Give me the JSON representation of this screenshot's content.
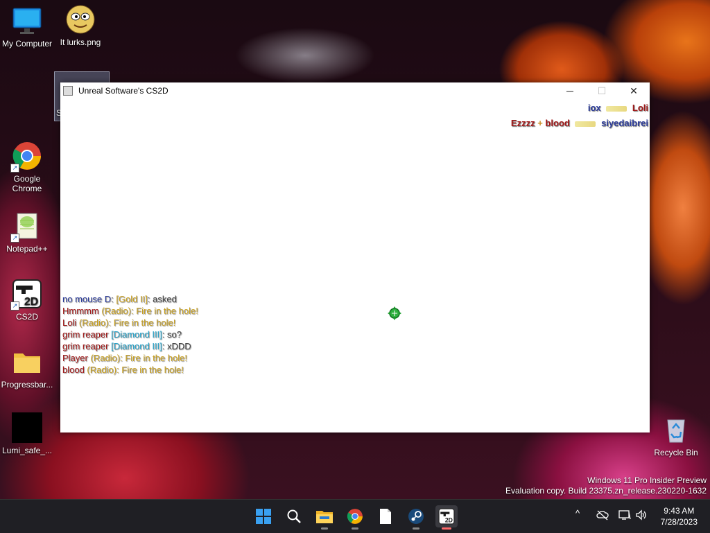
{
  "desktop": {
    "icons": [
      {
        "label": "My Computer"
      },
      {
        "label": "It lurks.png"
      },
      {
        "label": "Google Chrome"
      },
      {
        "label": "Notepad++"
      },
      {
        "label": "CS2D"
      },
      {
        "label": "Progressbar..."
      },
      {
        "label": "Lumi_safe_..."
      },
      {
        "label": "Recycle Bin"
      }
    ],
    "partial_label": "S"
  },
  "window": {
    "title": "Unreal Software's CS2D",
    "minimize": "─",
    "maximize": "☐",
    "close": "✕"
  },
  "killfeed": [
    {
      "killer": "iox",
      "victim": "Loli"
    },
    {
      "killer": "Ezzzz",
      "assist": "+",
      "assister": "blood",
      "victim": "siyedaibrei"
    }
  ],
  "chat": [
    {
      "name": "no mouse D",
      "tag": "[Gold II]",
      "sep": ":",
      "msg": " asked"
    },
    {
      "name": "Hmmmm",
      "tag": " (Radio)",
      "sep": ":",
      "msg": " Fire in the hole!"
    },
    {
      "name": "Loli",
      "tag": " (Radio)",
      "sep": ":",
      "msg": " Fire in the hole!"
    },
    {
      "name": "grim reaper",
      "tag": " [Diamond III]",
      "sep": ":",
      "msg": " so?"
    },
    {
      "name": "grim reaper",
      "tag": " [Diamond III]",
      "sep": ":",
      "msg": " xDDD"
    },
    {
      "name": "Player",
      "tag": " (Radio)",
      "sep": ":",
      "msg": " Fire in the hole!"
    },
    {
      "name": "blood",
      "tag": " (Radio)",
      "sep": ":",
      "msg": " Fire in the hole!"
    }
  ],
  "watermark": {
    "line1": "Windows 11 Pro Insider Preview",
    "line2": "Evaluation copy. Build 23375.zn_release.230220-1632"
  },
  "taskbar": {
    "apps": [
      "start-icon",
      "search-icon",
      "file-explorer-icon",
      "chrome-icon",
      "notepad-icon",
      "steam-icon",
      "cs2d-icon"
    ],
    "clock_time": "9:43 AM",
    "clock_date": "7/28/2023",
    "tray_chevron": "^"
  },
  "colors": {
    "ct_blue": "#2a3a9a",
    "t_red": "#a01818",
    "radio_gold": "#c8a020",
    "rank_cyan": "#20a0c8"
  }
}
